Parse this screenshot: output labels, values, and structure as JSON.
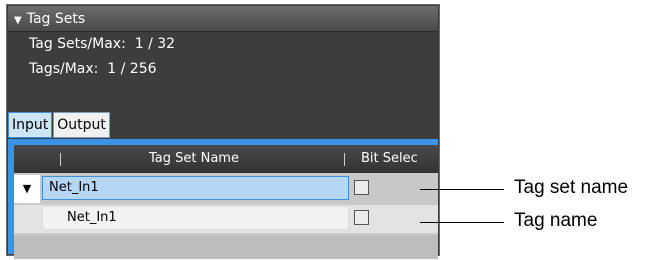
{
  "section": {
    "title": "Tag Sets",
    "tag_sets_line": "Tag Sets/Max:  1 / 32",
    "tags_line": "Tags/Max:  1 / 256"
  },
  "tabs": [
    {
      "label": "Input",
      "active": true
    },
    {
      "label": "Output",
      "active": false
    }
  ],
  "grid": {
    "columns": [
      "Tag Set Name",
      "Bit Selec"
    ],
    "rows": [
      {
        "name": "Net_In1",
        "kind": "tag-set",
        "expanded": true,
        "bit_selection": false
      },
      {
        "name": "Net_In1",
        "kind": "tag",
        "bit_selection": false
      }
    ]
  },
  "callouts": {
    "tag_set_name": "Tag set name",
    "tag_name": "Tag name"
  }
}
